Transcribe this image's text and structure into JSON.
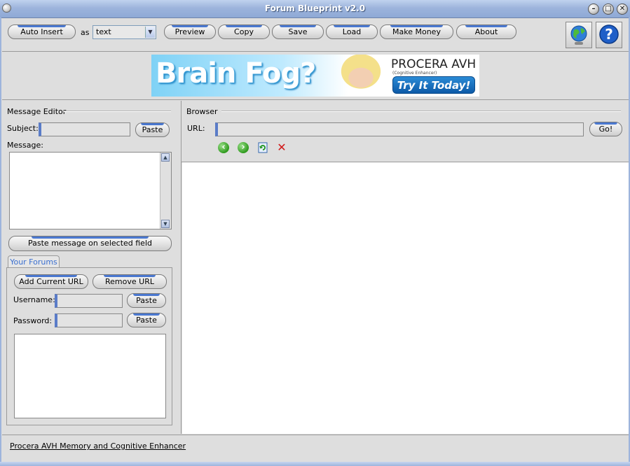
{
  "window": {
    "title": "Forum Blueprint v2.0",
    "controls": {
      "minimize": "–",
      "maximize": "□",
      "close": "✕"
    }
  },
  "toolbar": {
    "auto_insert": "Auto Insert",
    "as_label": "as",
    "format_value": "text",
    "preview": "Preview",
    "copy": "Copy",
    "save": "Save",
    "load": "Load",
    "make_money": "Make Money",
    "about": "About",
    "icons": {
      "web": "globe-icon",
      "help": "help-icon"
    }
  },
  "banner": {
    "headline": "Brain Fog?",
    "brand": "PROCERA AVH",
    "subtitle": "(Cognitive Enhancer)",
    "cta": "Try It Today!"
  },
  "message_editor": {
    "title": "Message Editor",
    "subject_label": "Subject:",
    "subject_value": "",
    "paste": "Paste",
    "message_label": "Message:",
    "message_value": "",
    "paste_message": "Paste message on selected field"
  },
  "forums": {
    "tab": "Your Forums",
    "add_url": "Add Current URL",
    "remove_url": "Remove URL",
    "username_label": "Username:",
    "password_label": "Password:",
    "paste": "Paste"
  },
  "browser": {
    "title": "Browser",
    "url_label": "URL:",
    "url_value": "",
    "go": "Go!",
    "nav": {
      "back": "back-arrow-icon",
      "forward": "forward-arrow-icon",
      "refresh": "refresh-icon",
      "stop": "stop-icon"
    }
  },
  "status": {
    "link": "Procera AVH Memory and Cognitive Enhancer"
  },
  "colors": {
    "titlebar": "#9db4dc",
    "accent": "#4a78d0",
    "panel": "#dedede"
  }
}
